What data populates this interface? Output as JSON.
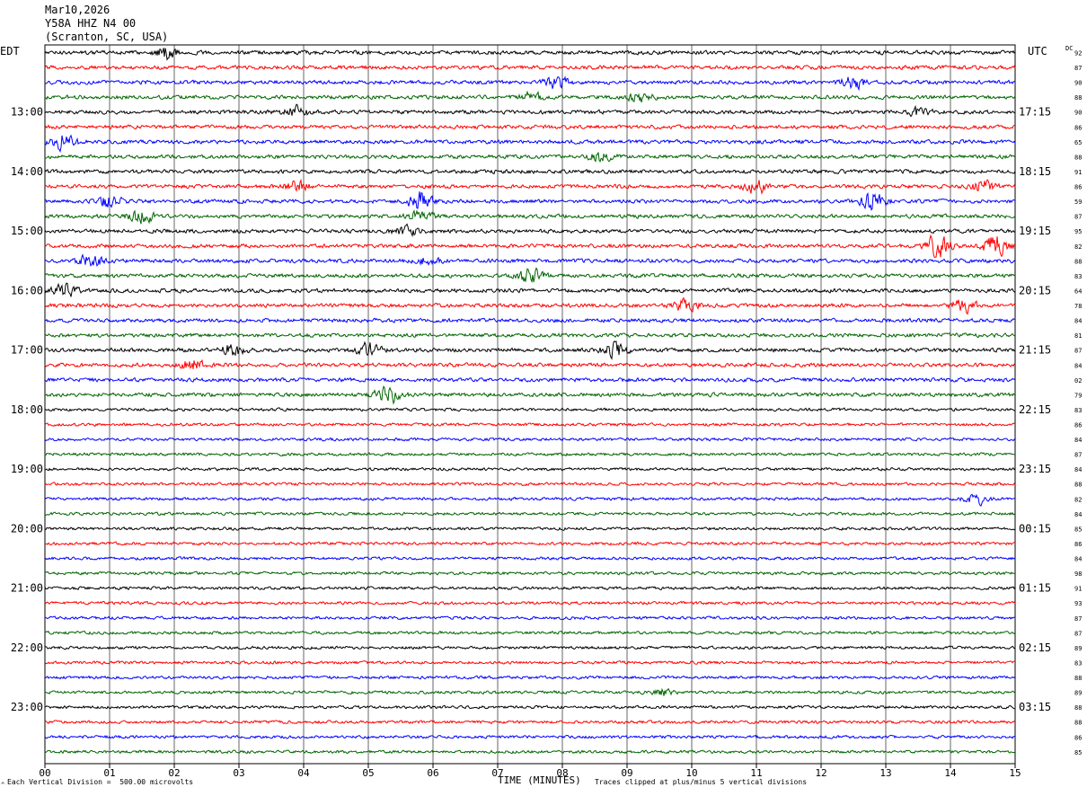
{
  "header": {
    "date": "Mar10,2026",
    "station": "Y58A HHZ N4 00",
    "location": "(Scranton, SC, USA)"
  },
  "left_zone_label": "EDT",
  "right_zone_label": "UTC",
  "dc_label": "DC",
  "footer": {
    "left_note": "Each Vertical Division =  500.00 microvolts",
    "right_note": "Traces clipped at plus/minus 5 vertical divisions",
    "corner_mark": "^"
  },
  "colors": {
    "trace_cycle": [
      "#000000",
      "#ff0000",
      "#0000ff",
      "#006400"
    ],
    "grid": "#000000",
    "background": "#ffffff"
  },
  "chart_data": {
    "type": "line",
    "title": "",
    "xlabel": "TIME (MINUTES)",
    "ylabel": "",
    "xlim": [
      0,
      15
    ],
    "x_ticks": [
      "00",
      "01",
      "02",
      "03",
      "04",
      "05",
      "06",
      "07",
      "08",
      "09",
      "10",
      "11",
      "12",
      "13",
      "14",
      "15"
    ],
    "grid": true,
    "trace_count": 48,
    "minutes_per_trace": 15,
    "left_hour_labels": [
      "13:00",
      "14:00",
      "15:00",
      "16:00",
      "17:00",
      "18:00",
      "19:00",
      "20:00",
      "21:00",
      "22:00",
      "23:00"
    ],
    "right_hour_labels": [
      "17:15",
      "18:15",
      "19:15",
      "20:15",
      "21:15",
      "22:15",
      "23:15",
      "00:15",
      "01:15",
      "02:15",
      "03:15"
    ],
    "first_hour_label_trace_index": 4,
    "traces_per_hour": 4,
    "dc_offsets": [
      "92",
      "87",
      "90",
      "88",
      "90",
      "86",
      "65",
      "88",
      "91",
      "86",
      "59",
      "87",
      "95",
      "82",
      "88",
      "83",
      "64",
      "78",
      "84",
      "81",
      "87",
      "84",
      "02",
      "79",
      "83",
      "86",
      "84",
      "87",
      "84",
      "88",
      "82",
      "84",
      "85",
      "86",
      "84",
      "98",
      "91",
      "93",
      "87",
      "87",
      "89",
      "83",
      "88",
      "89",
      "88",
      "88",
      "86",
      "85"
    ],
    "bursts": [
      {
        "trace": 0,
        "minute": 1.9,
        "amplitude": 5
      },
      {
        "trace": 2,
        "minute": 7.9,
        "amplitude": 5
      },
      {
        "trace": 2,
        "minute": 12.5,
        "amplitude": 5
      },
      {
        "trace": 3,
        "minute": 7.5,
        "amplitude": 4
      },
      {
        "trace": 3,
        "minute": 9.2,
        "amplitude": 4
      },
      {
        "trace": 4,
        "minute": 3.9,
        "amplitude": 4
      },
      {
        "trace": 4,
        "minute": 13.5,
        "amplitude": 3
      },
      {
        "trace": 6,
        "minute": 0.3,
        "amplitude": 7
      },
      {
        "trace": 7,
        "minute": 8.6,
        "amplitude": 4
      },
      {
        "trace": 9,
        "minute": 3.9,
        "amplitude": 4
      },
      {
        "trace": 9,
        "minute": 11.0,
        "amplitude": 5
      },
      {
        "trace": 9,
        "minute": 14.5,
        "amplitude": 4
      },
      {
        "trace": 10,
        "minute": 1.0,
        "amplitude": 5
      },
      {
        "trace": 10,
        "minute": 5.8,
        "amplitude": 7
      },
      {
        "trace": 10,
        "minute": 12.8,
        "amplitude": 7
      },
      {
        "trace": 11,
        "minute": 1.5,
        "amplitude": 5
      },
      {
        "trace": 11,
        "minute": 5.8,
        "amplitude": 4
      },
      {
        "trace": 12,
        "minute": 5.6,
        "amplitude": 4
      },
      {
        "trace": 13,
        "minute": 13.8,
        "amplitude": 10
      },
      {
        "trace": 13,
        "minute": 14.7,
        "amplitude": 9
      },
      {
        "trace": 14,
        "minute": 0.7,
        "amplitude": 5
      },
      {
        "trace": 14,
        "minute": 5.9,
        "amplitude": 3
      },
      {
        "trace": 15,
        "minute": 7.5,
        "amplitude": 6
      },
      {
        "trace": 16,
        "minute": 0.3,
        "amplitude": 5
      },
      {
        "trace": 17,
        "minute": 9.9,
        "amplitude": 4
      },
      {
        "trace": 17,
        "minute": 14.2,
        "amplitude": 5
      },
      {
        "trace": 20,
        "minute": 2.9,
        "amplitude": 5
      },
      {
        "trace": 20,
        "minute": 5.0,
        "amplitude": 5
      },
      {
        "trace": 20,
        "minute": 8.8,
        "amplitude": 6
      },
      {
        "trace": 21,
        "minute": 2.3,
        "amplitude": 5
      },
      {
        "trace": 23,
        "minute": 5.3,
        "amplitude": 7
      },
      {
        "trace": 30,
        "minute": 14.4,
        "amplitude": 4
      },
      {
        "trace": 43,
        "minute": 9.5,
        "amplitude": 3
      }
    ]
  }
}
